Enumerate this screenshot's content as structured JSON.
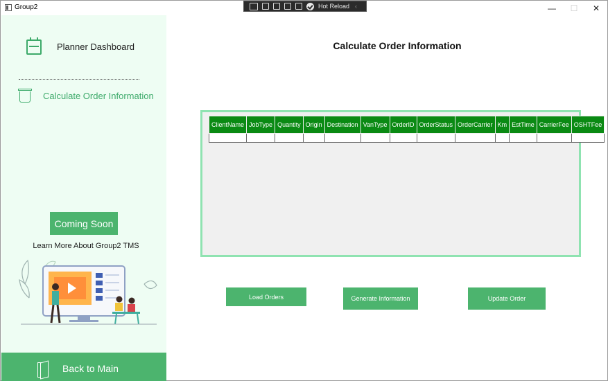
{
  "window": {
    "title": "Group2",
    "controls": {
      "minimize": "—",
      "maximize": "☐",
      "close": "✕"
    }
  },
  "hot_reload": {
    "label": "Hot Reload",
    "arrow": "‹"
  },
  "sidebar": {
    "items": [
      {
        "label": "Planner Dashboard",
        "icon": "calendar-icon",
        "active": false
      },
      {
        "label": "Calculate Order Information",
        "icon": "trash-bin-icon",
        "active": true
      }
    ],
    "coming_soon": "Coming Soon",
    "learn_more": "Learn More About Group2 TMS",
    "back_label": "Back to Main"
  },
  "main": {
    "title": "Calculate Order Information",
    "grid": {
      "columns": [
        "ClientName",
        "JobType",
        "Quantity",
        "Origin",
        "Destination",
        "VanType",
        "OrderID",
        "OrderStatus",
        "OrderCarrier",
        "Km",
        "EstTime",
        "CarrierFee",
        "OSHTFee"
      ],
      "rows": 1
    },
    "buttons": {
      "load": "Load Orders",
      "generate": "Generate Information",
      "update": "Update Order"
    }
  },
  "colors": {
    "accent": "#4cb46e",
    "sidebar_bg": "#eefdf3",
    "grid_header": "#0a8a13",
    "grid_border": "#8fe3b1"
  }
}
